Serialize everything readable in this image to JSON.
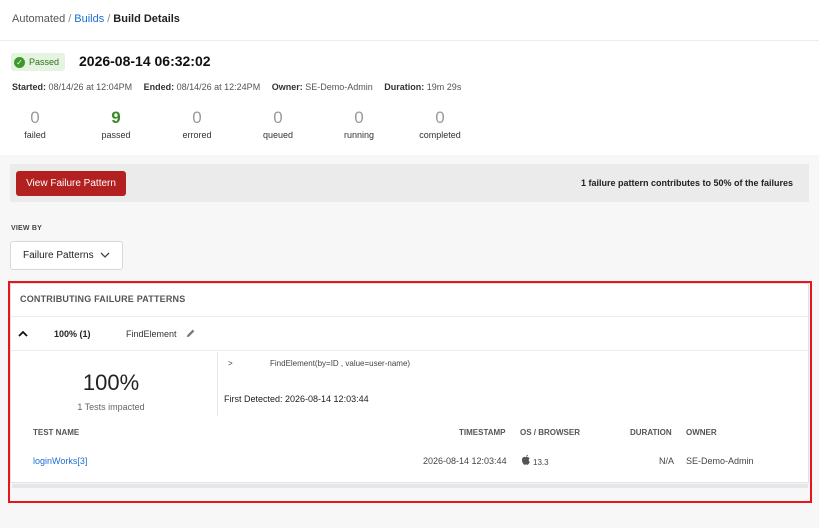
{
  "breadcrumb": {
    "items": [
      {
        "label": "Automated"
      },
      {
        "label": "Builds"
      },
      {
        "label": "Build Details"
      }
    ],
    "separator": "/"
  },
  "build": {
    "status": "Passed",
    "title": "2026-08-14 06:32:02",
    "meta": {
      "started_label": "Started:",
      "started_value": "08/14/26 at 12:04PM",
      "ended_label": "Ended:",
      "ended_value": "08/14/26 at 12:24PM",
      "owner_label": "Owner:",
      "owner_value": "SE-Demo-Admin",
      "duration_label": "Duration:",
      "duration_value": "19m 29s"
    }
  },
  "stats": [
    {
      "value": "0",
      "label": "failed"
    },
    {
      "value": "9",
      "label": "passed"
    },
    {
      "value": "0",
      "label": "errored"
    },
    {
      "value": "0",
      "label": "queued"
    },
    {
      "value": "0",
      "label": "running"
    },
    {
      "value": "0",
      "label": "completed"
    }
  ],
  "failure_bar": {
    "button_label": "View Failure Pattern",
    "summary": "1 failure pattern contributes to 50% of the failures"
  },
  "view_by": {
    "label": "VIEW BY",
    "selected": "Failure Patterns"
  },
  "patterns_panel": {
    "title": "CONTRIBUTING FAILURE PATTERNS",
    "pattern": {
      "percent_count": "100% (1)",
      "name": "FindElement",
      "big_percent": "100%",
      "impacted": "1 Tests impacted",
      "prompt": ">",
      "trace": "FindElement(by=ID , value=user-name)",
      "first_detected": "First Detected: 2026-08-14 12:03:44"
    },
    "table": {
      "headers": {
        "test_name": "TEST NAME",
        "timestamp": "TIMESTAMP",
        "os_browser": "OS / BROWSER",
        "duration": "DURATION",
        "owner": "OWNER"
      },
      "rows": [
        {
          "test_name": "loginWorks[3]",
          "timestamp": "2026-08-14 12:03:44",
          "os_icon": "apple-icon",
          "os_version": "13.3",
          "duration": "N/A",
          "owner": "SE-Demo-Admin"
        }
      ]
    }
  },
  "colors": {
    "accent_link": "#1a6fd0",
    "passed_green": "#3a8a2a",
    "danger_button": "#b32020",
    "highlight_border": "#e8161a"
  }
}
